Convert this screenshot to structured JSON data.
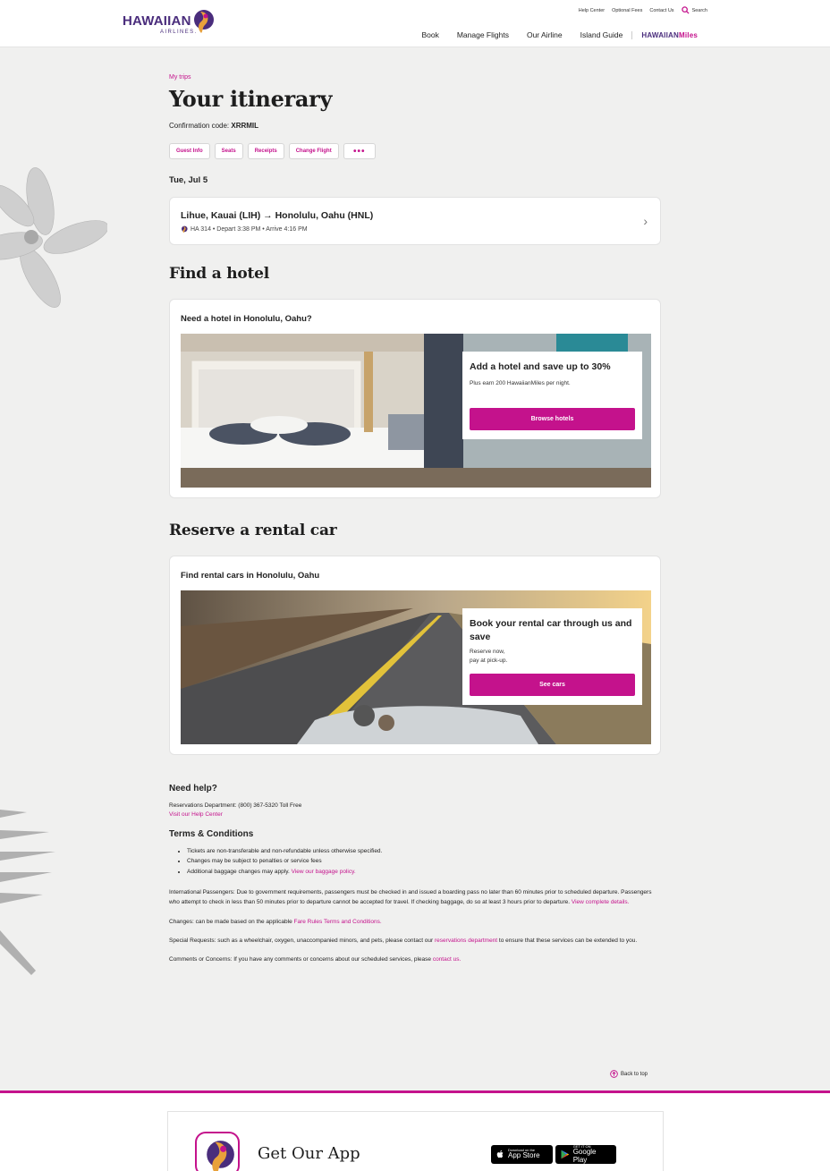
{
  "brand": {
    "logo_text": "HAWAIIAN",
    "logo_sub": "AIRLINES."
  },
  "util_nav": {
    "help": "Help Center",
    "fees": "Optional Fees",
    "contact": "Contact Us",
    "search": "Search"
  },
  "main_nav": {
    "book": "Book",
    "manage": "Manage Flights",
    "airline": "Our Airline",
    "guide": "Island Guide",
    "miles_a": "HAWAIIAN",
    "miles_b": "Miles"
  },
  "page": {
    "breadcrumb": "My trips",
    "title": "Your itinerary",
    "confirm_label": "Confirmation code: ",
    "confirm_code": "XRRMIL",
    "pills": [
      "Guest Info",
      "Seats",
      "Receipts",
      "Change Flight",
      "•••"
    ],
    "date": "Tue, Jul 5"
  },
  "flight": {
    "route": "Lihue, Kauai (LIH) → Honolulu, Oahu (HNL)",
    "info": "HA 314 • Depart 3:38 PM • Arrive 4:16 PM"
  },
  "hotel": {
    "section": "Find a hotel",
    "heading": "Need a hotel in Honolulu, Oahu?",
    "box_title": "Add a hotel and save up to 30%",
    "box_text": "Plus earn 200 HawaiianMiles per night.",
    "button": "Browse hotels"
  },
  "car": {
    "section": "Reserve a rental car",
    "heading": "Find rental cars in Honolulu, Oahu",
    "box_title": "Book your rental car through us and save",
    "box_text_1": "Reserve now,",
    "box_text_2": "pay at pick-up.",
    "button": "See cars"
  },
  "help": {
    "title": "Need help?",
    "reservations": "Reservations Department: (800) 367-5320 Toll Free",
    "help_link": "Visit our Help Center",
    "terms_title": "Terms & Conditions",
    "terms": [
      "Tickets are non-transferable and non-refundable unless otherwise specified.",
      "Changes may be subject to penalties or service fees",
      "Additional baggage changes may apply. "
    ],
    "baggage_link": "View our baggage policy.",
    "intl_text": "International Passengers: Due to government requirements, passengers must be checked in and issued a boarding pass no later than 60 minutes prior to scheduled departure. Passengers who attempt to check in less than 50 minutes prior to departure cannot be accepted for travel. If checking baggage, do so at least 3 hours prior to departure. ",
    "intl_link": "View complete details.",
    "changes_text": "Changes: can be made based on the applicable ",
    "changes_link": "Fare Rules Terms and Conditions.",
    "special_text": "Special Requests: such as a wheelchair, oxygen, unaccompanied minors, and pets, please contact our ",
    "special_link": "reservations department",
    "special_text_2": " to ensure that these services can be extended to you.",
    "comments_text": "Comments or Concerns: If you have any comments or concerns about our scheduled services, please ",
    "comments_link": "contact us."
  },
  "footer": {
    "back_to_top": "Back to top",
    "app_title": "Get Our App",
    "appstore_small": "Download on the",
    "appstore_big": "App Store",
    "gplay_small": "GET IT ON",
    "gplay_big": "Google Play"
  },
  "colors": {
    "accent": "#c4128c",
    "brand_purple": "#4a2d7c",
    "page_bg": "#f0f0ef"
  },
  "icons": [
    "hawaiian-logo-icon",
    "search-icon",
    "plumeria-flower-icon",
    "palm-leaf-icon",
    "chevron-right-icon",
    "arrow-up-circle-icon",
    "apple-icon",
    "google-play-icon"
  ]
}
